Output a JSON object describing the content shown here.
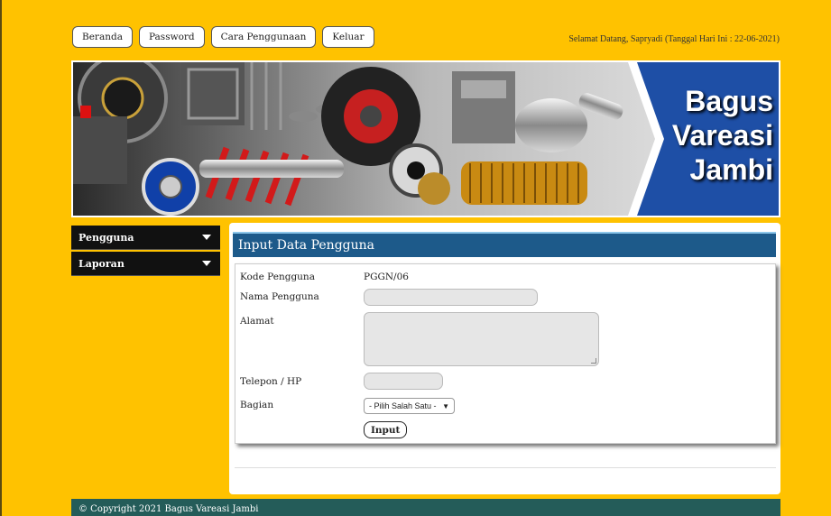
{
  "nav": {
    "items": [
      "Beranda",
      "Password",
      "Cara Penggunaan",
      "Keluar"
    ],
    "welcome": "Selamat Datang, Sapryadi (Tanggal Hari Ini : 22-06-2021)"
  },
  "banner": {
    "lines": [
      "Bagus",
      "Vareasi",
      "Jambi"
    ]
  },
  "sidebar": {
    "items": [
      {
        "label": "Pengguna"
      },
      {
        "label": "Laporan"
      }
    ]
  },
  "form": {
    "title": "Input Data Pengguna",
    "kode_label": "Kode Pengguna",
    "kode_value": "PGGN/06",
    "nama_label": "Nama Pengguna",
    "nama_value": "",
    "alamat_label": "Alamat",
    "alamat_value": "",
    "telepon_label": "Telepon / HP",
    "telepon_value": "",
    "bagian_label": "Bagian",
    "bagian_selected": "- Pilih Salah Satu -",
    "submit_label": "Input"
  },
  "footer": {
    "text": "© Copyright 2021 Bagus Vareasi Jambi"
  },
  "colors": {
    "background": "#FFC200",
    "panel_header": "#1d5a8a",
    "footer": "#245c59",
    "sidebar": "#111111",
    "banner_blue": "#1e4fa6"
  }
}
